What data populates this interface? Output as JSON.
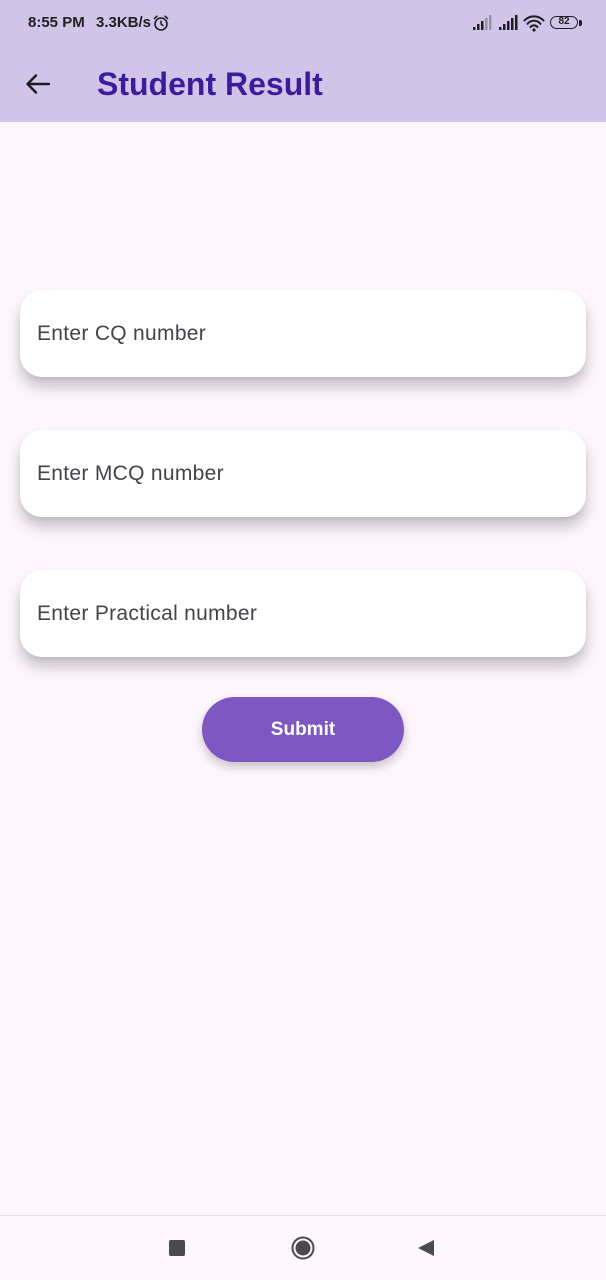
{
  "status_bar": {
    "time": "8:55 PM",
    "network_speed": "3.3KB/s",
    "battery_level": "82",
    "icons": [
      "alarm-icon",
      "signal-icon",
      "signal-icon",
      "wifi-icon",
      "battery-icon"
    ]
  },
  "app_bar": {
    "title": "Student Result",
    "back_icon": "arrow-left-icon",
    "background_color": "#d0c4e9",
    "title_color": "#3a1d9a"
  },
  "form": {
    "cq_field": {
      "placeholder": "Enter CQ number",
      "value": ""
    },
    "mcq_field": {
      "placeholder": "Enter MCQ number",
      "value": ""
    },
    "practical_field": {
      "placeholder": "Enter Practical number",
      "value": ""
    },
    "submit_label": "Submit",
    "accent_color": "#7e57c2"
  },
  "nav_bar": {
    "icons": [
      "recents-square-icon",
      "home-circle-icon",
      "back-triangle-icon"
    ]
  }
}
